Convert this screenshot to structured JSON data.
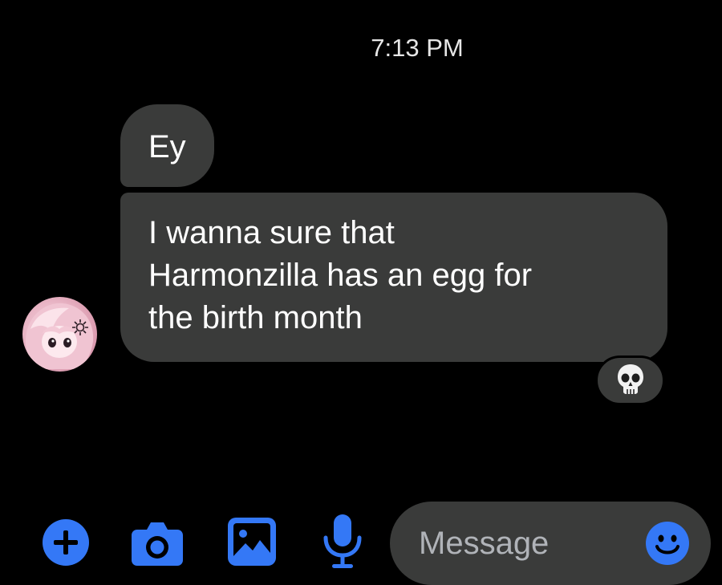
{
  "conversation": {
    "timestamp": "7:13 PM",
    "messages": [
      {
        "sender": "other",
        "lines": [
          "Ey"
        ]
      },
      {
        "sender": "other",
        "lines": [
          "I wanna sure that",
          "Harmonzilla has an egg for",
          "the birth month"
        ],
        "reaction": "skull-emoji"
      }
    ],
    "avatar": "contact-avatar"
  },
  "composer": {
    "placeholder": "Message",
    "icons": [
      "plus-icon",
      "camera-icon",
      "gallery-icon",
      "microphone-icon",
      "emoji-icon"
    ]
  },
  "colors": {
    "background": "#000000",
    "bubble": "#3a3b3a",
    "accent": "#3478f6",
    "placeholder": "#b0b3b8"
  }
}
